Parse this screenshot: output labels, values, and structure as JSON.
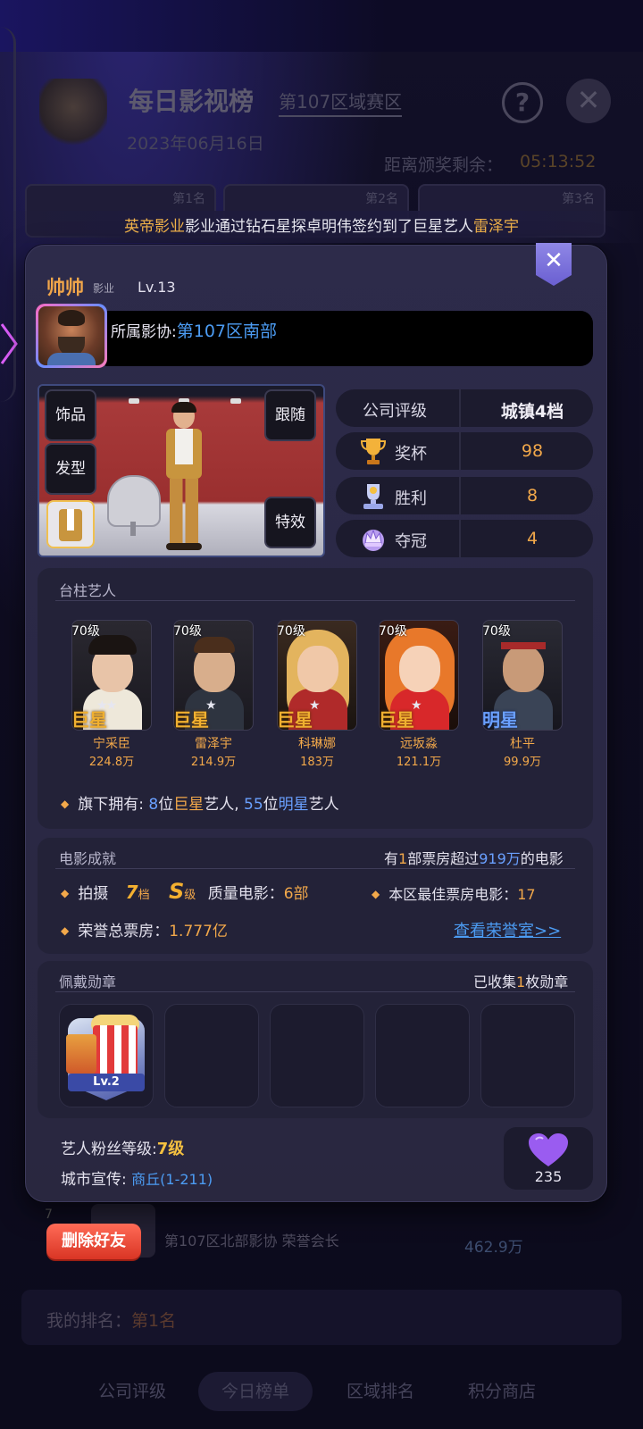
{
  "background": {
    "title": "每日影视榜",
    "zone_link": "第107区域赛区",
    "date": "2023年06月16日",
    "countdown_label": "距离颁奖剩余：",
    "countdown_value": "05:13:52",
    "rank_tabs": [
      "第1名",
      "第2名",
      "第3名"
    ],
    "row7": {
      "rank": "7",
      "text": "第107区北部影协  荣誉会长",
      "value": "462.9万"
    },
    "my_rank_label": "我的排名：",
    "my_rank_value": "第1名",
    "bottom_tabs": [
      "公司评级",
      "今日榜单",
      "区域排名",
      "积分商店"
    ]
  },
  "banner": {
    "company": "英帝影业",
    "text_middle": "影业通过钻石星探卓明伟签约到了巨星艺人",
    "artist": "雷泽宇"
  },
  "profile": {
    "name": "帅帅",
    "name_suffix": "影业",
    "level": "Lv.13",
    "association_label": "所属影协:",
    "association_value": "第107区南部"
  },
  "showcase": {
    "btn_accessory": "饰品",
    "btn_hair": "发型",
    "btn_follow": "跟随",
    "btn_effect": "特效"
  },
  "stats": {
    "rating_label": "公司评级",
    "rating_value": "城镇4档",
    "trophy_label": "奖杯",
    "trophy_value": "98",
    "win_label": "胜利",
    "win_value": "8",
    "champion_label": "夺冠",
    "champion_value": "4"
  },
  "artists_section": {
    "title": "台柱艺人",
    "artists": [
      {
        "level": "70级",
        "tier": "巨星",
        "name": "宁采臣",
        "fans": "224.8万"
      },
      {
        "level": "70级",
        "tier": "巨星",
        "name": "雷泽宇",
        "fans": "214.9万"
      },
      {
        "level": "70级",
        "tier": "巨星",
        "name": "科琳娜",
        "fans": "183万"
      },
      {
        "level": "70级",
        "tier": "巨星",
        "name": "远坂淼",
        "fans": "121.1万"
      },
      {
        "level": "70级",
        "tier": "明星",
        "name": "杜平",
        "fans": "99.9万"
      }
    ],
    "own_prefix": "旗下拥有: ",
    "own_superstar_count": "8",
    "own_mid1": "位",
    "own_superstar": "巨星",
    "own_mid2": "艺人, ",
    "own_star_count": "55",
    "own_mid3": "位",
    "own_star": "明星",
    "own_suffix": "艺人"
  },
  "movie_section": {
    "title": "电影成就",
    "right_prefix": "有",
    "right_count": "1",
    "right_mid": "部票房超过",
    "right_amount": "919万",
    "right_suffix": "的电影",
    "shoot_label": "拍摄",
    "shoot_grade_num": "7",
    "shoot_grade_unit": "档",
    "shoot_s": "S",
    "shoot_s_unit": "级",
    "quality_label": "质量电影：",
    "quality_value": "6部",
    "best_label": "本区最佳票房电影：",
    "best_value": "17",
    "honor_label": "荣誉总票房：",
    "honor_value": "1.777亿",
    "honor_link": "查看荣誉室>>"
  },
  "badge_section": {
    "title": "佩戴勋章",
    "collected_prefix": "已收集",
    "collected_count": "1",
    "collected_suffix": "枚勋章",
    "badge_level": "Lv.2"
  },
  "footer": {
    "fan_level_label": "艺人粉丝等级:",
    "fan_level_value": "7级",
    "city_label": "城市宣传: ",
    "city_value": "商丘(1-211)",
    "likes": "235",
    "delete_friend": "删除好友"
  },
  "colors": {
    "accent_gold": "#f2a84a",
    "accent_blue": "#4c9cf3",
    "delete_red": "#e2402d",
    "card_bg": "#2b2946"
  }
}
